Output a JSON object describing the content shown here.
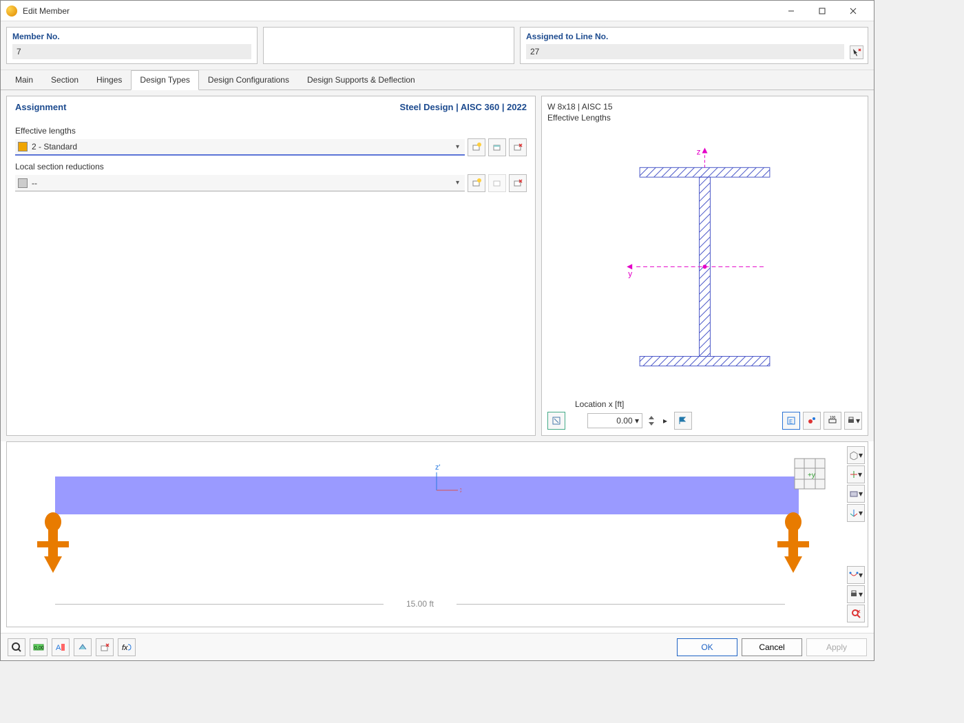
{
  "title": "Edit Member",
  "member_no_label": "Member No.",
  "member_no": "7",
  "assigned_label": "Assigned to Line No.",
  "assigned_to": "27",
  "tabs": {
    "main": "Main",
    "section": "Section",
    "hinges": "Hinges",
    "design_types": "Design Types",
    "design_config": "Design Configurations",
    "design_supports": "Design Supports & Deflection"
  },
  "active_tab": "design_types",
  "assignment": {
    "label": "Assignment",
    "standard": "Steel Design | AISC 360 | 2022"
  },
  "effective_lengths": {
    "label": "Effective lengths",
    "value": "2 - Standard"
  },
  "local_section": {
    "label": "Local section reductions",
    "value": "--"
  },
  "section_view": {
    "title1": "W 8x18 | AISC 15",
    "title2": "Effective Lengths",
    "z": "z",
    "y": "y"
  },
  "location": {
    "label": "Location x [ft]",
    "value": "0.00"
  },
  "member_view": {
    "length": "15.00 ft",
    "zaxis": "z'",
    "xaxis": "x"
  },
  "buttons": {
    "ok": "OK",
    "cancel": "Cancel",
    "apply": "Apply"
  }
}
